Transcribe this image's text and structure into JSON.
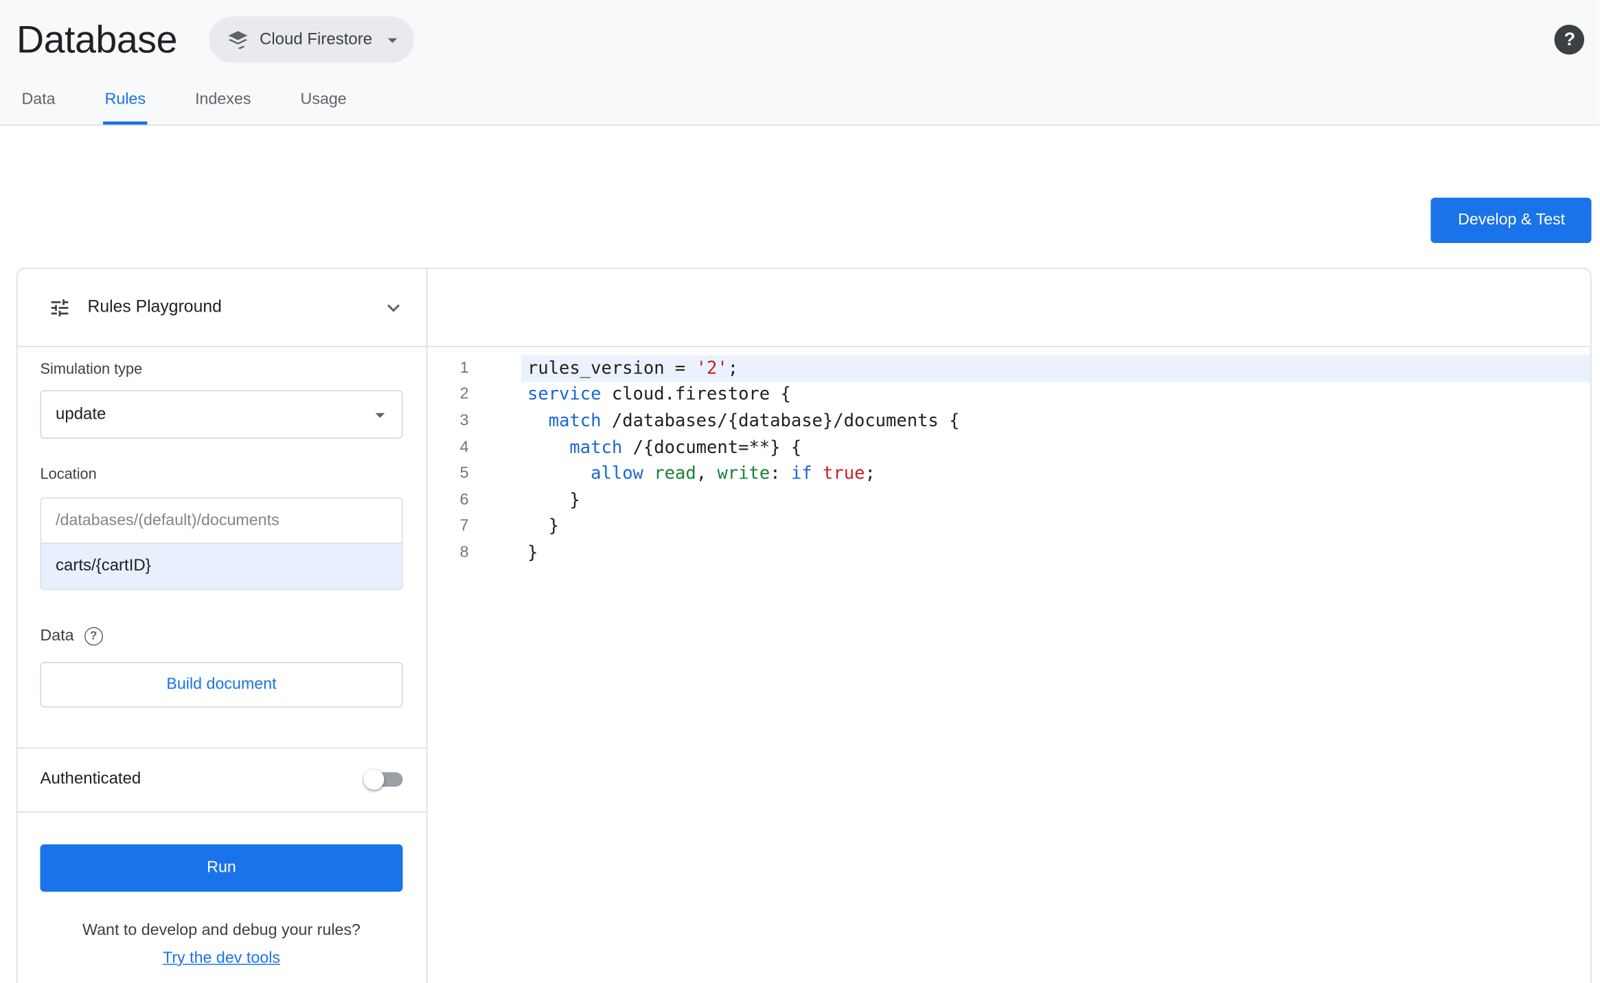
{
  "header": {
    "title": "Database",
    "product_selector_label": "Cloud Firestore",
    "help_icon": "?"
  },
  "tabs": [
    {
      "label": "Data",
      "active": false
    },
    {
      "label": "Rules",
      "active": true
    },
    {
      "label": "Indexes",
      "active": false
    },
    {
      "label": "Usage",
      "active": false
    }
  ],
  "actions": {
    "develop_test_label": "Develop & Test"
  },
  "playground": {
    "title": "Rules Playground",
    "simulation_type": {
      "label": "Simulation type",
      "value": "update"
    },
    "location": {
      "label": "Location",
      "base_path": "/databases/(default)/documents",
      "value": "carts/{cartID}"
    },
    "data_section": {
      "label": "Data",
      "help": "?",
      "build_button": "Build document"
    },
    "authenticated": {
      "label": "Authenticated",
      "enabled": false
    },
    "run_button": "Run",
    "dev_tools": {
      "prompt": "Want to develop and debug your rules?",
      "link": "Try the dev tools"
    }
  },
  "editor": {
    "active_line": 1,
    "lines": [
      {
        "n": 1,
        "tokens": [
          [
            "rules_version = ",
            "p"
          ],
          [
            "'2'",
            "s"
          ],
          [
            ";",
            "p"
          ]
        ]
      },
      {
        "n": 2,
        "tokens": [
          [
            "service",
            "k"
          ],
          [
            " cloud.firestore {",
            "p"
          ]
        ]
      },
      {
        "n": 3,
        "tokens": [
          [
            "  ",
            "p"
          ],
          [
            "match",
            "k"
          ],
          [
            " /databases/{database}/documents {",
            "p"
          ]
        ]
      },
      {
        "n": 4,
        "tokens": [
          [
            "    ",
            "p"
          ],
          [
            "match",
            "k"
          ],
          [
            " /{document=**} {",
            "p"
          ]
        ]
      },
      {
        "n": 5,
        "tokens": [
          [
            "      ",
            "p"
          ],
          [
            "allow",
            "k"
          ],
          [
            " ",
            "p"
          ],
          [
            "read",
            "m"
          ],
          [
            ", ",
            "p"
          ],
          [
            "write",
            "m"
          ],
          [
            ": ",
            "p"
          ],
          [
            "if",
            "k"
          ],
          [
            " ",
            "p"
          ],
          [
            "true",
            "s"
          ],
          [
            ";",
            "p"
          ]
        ]
      },
      {
        "n": 6,
        "tokens": [
          [
            "    }",
            "p"
          ]
        ]
      },
      {
        "n": 7,
        "tokens": [
          [
            "  }",
            "p"
          ]
        ]
      },
      {
        "n": 8,
        "tokens": [
          [
            "}",
            "p"
          ]
        ]
      }
    ]
  },
  "colors": {
    "accent": "#1a73e8",
    "code-plain": "#202124",
    "code-keyword": "#1967d2",
    "code-literal": "#c5221f",
    "code-access": "#188038",
    "active-line-bg": "#ecf2fd"
  }
}
